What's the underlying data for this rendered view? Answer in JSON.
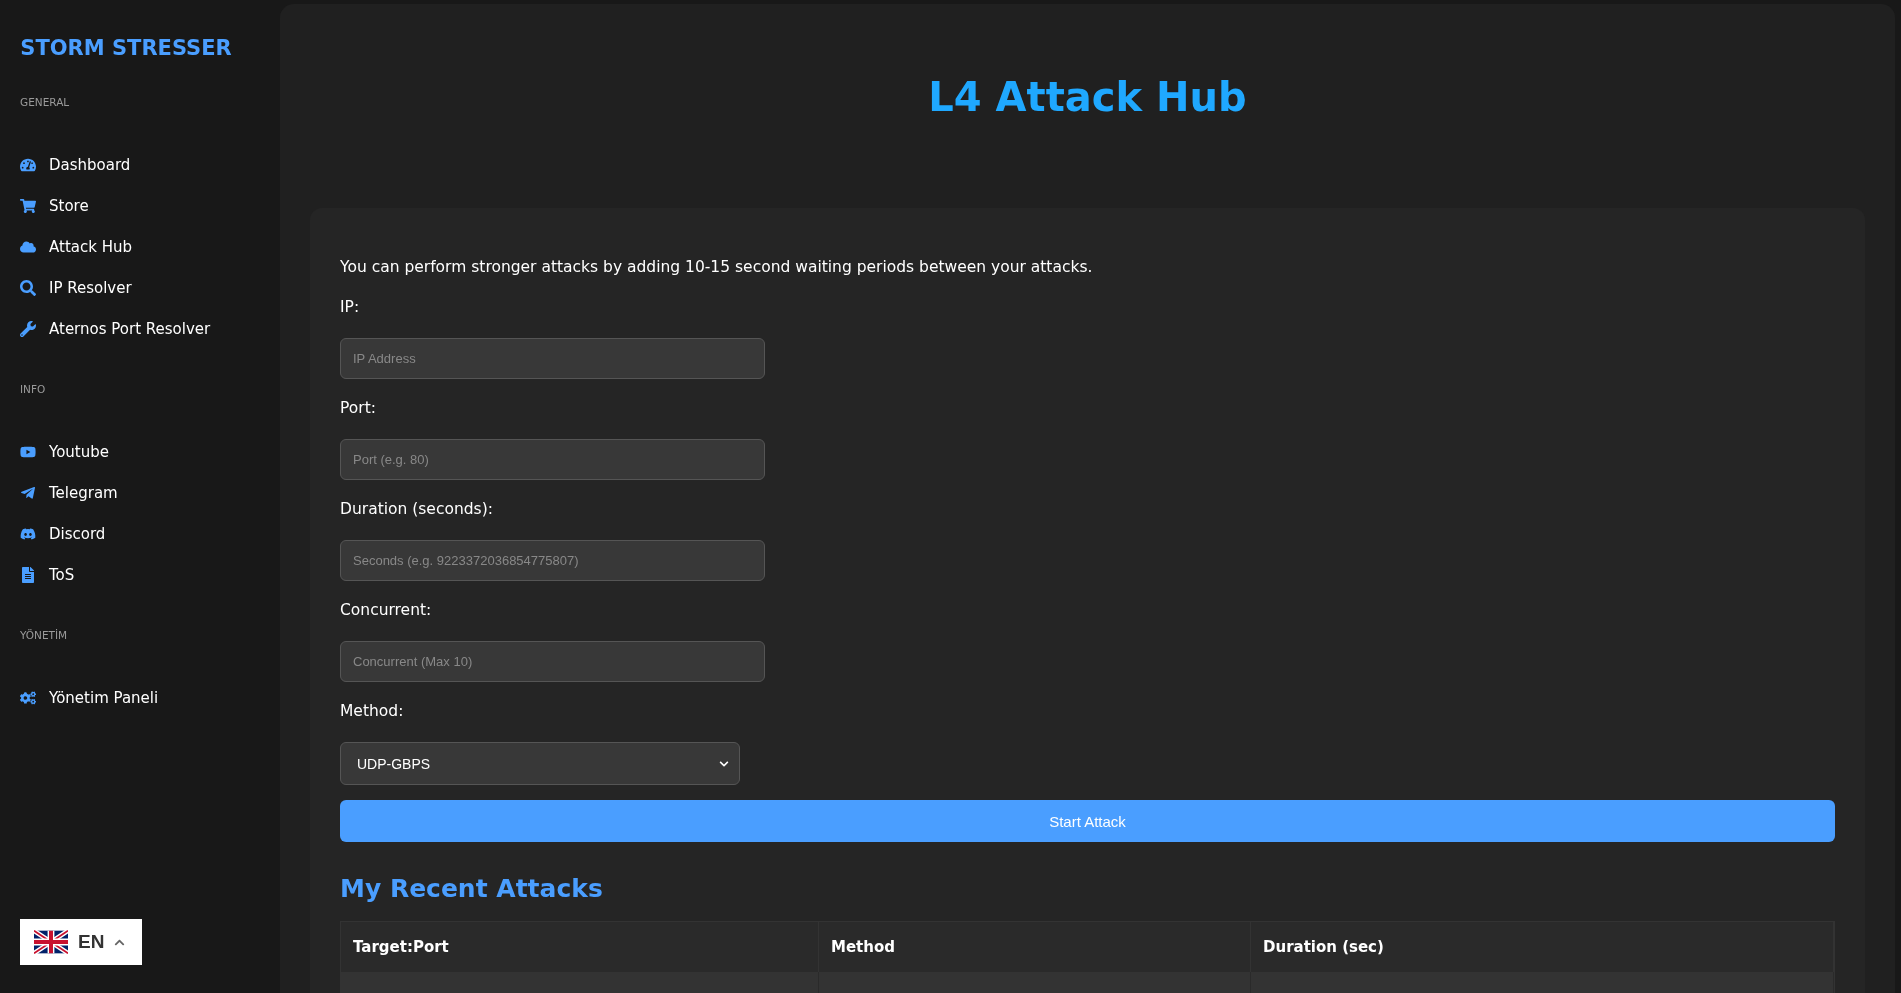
{
  "sidebar": {
    "brand": "STORM STRESSER",
    "sections": [
      {
        "heading": "GENERAL",
        "items": [
          {
            "label": "Dashboard"
          },
          {
            "label": "Store"
          },
          {
            "label": "Attack Hub"
          },
          {
            "label": "IP Resolver"
          },
          {
            "label": "Aternos Port Resolver"
          }
        ]
      },
      {
        "heading": "INFO",
        "items": [
          {
            "label": "Youtube"
          },
          {
            "label": "Telegram"
          },
          {
            "label": "Discord"
          },
          {
            "label": "ToS"
          }
        ]
      },
      {
        "heading": "YÖNETİM",
        "items": [
          {
            "label": "Yönetim Paneli"
          }
        ]
      }
    ],
    "language": {
      "code": "EN"
    }
  },
  "main": {
    "title": "L4 Attack Hub",
    "notice": "You can perform stronger attacks by adding 10-15 second waiting periods between your attacks.",
    "fields": [
      {
        "label": "IP:",
        "placeholder": "IP Address"
      },
      {
        "label": "Port:",
        "placeholder": "Port (e.g. 80)"
      },
      {
        "label": "Duration (seconds):",
        "placeholder": "Seconds (e.g. 9223372036854775807)"
      },
      {
        "label": "Concurrent:",
        "placeholder": "Concurrent (Max 10)"
      }
    ],
    "method": {
      "label": "Method:",
      "value": "UDP-GBPS"
    },
    "submit": "Start Attack",
    "recent": {
      "title": "My Recent Attacks",
      "columns": [
        "Target:Port",
        "Method",
        "Duration (sec)"
      ]
    }
  }
}
